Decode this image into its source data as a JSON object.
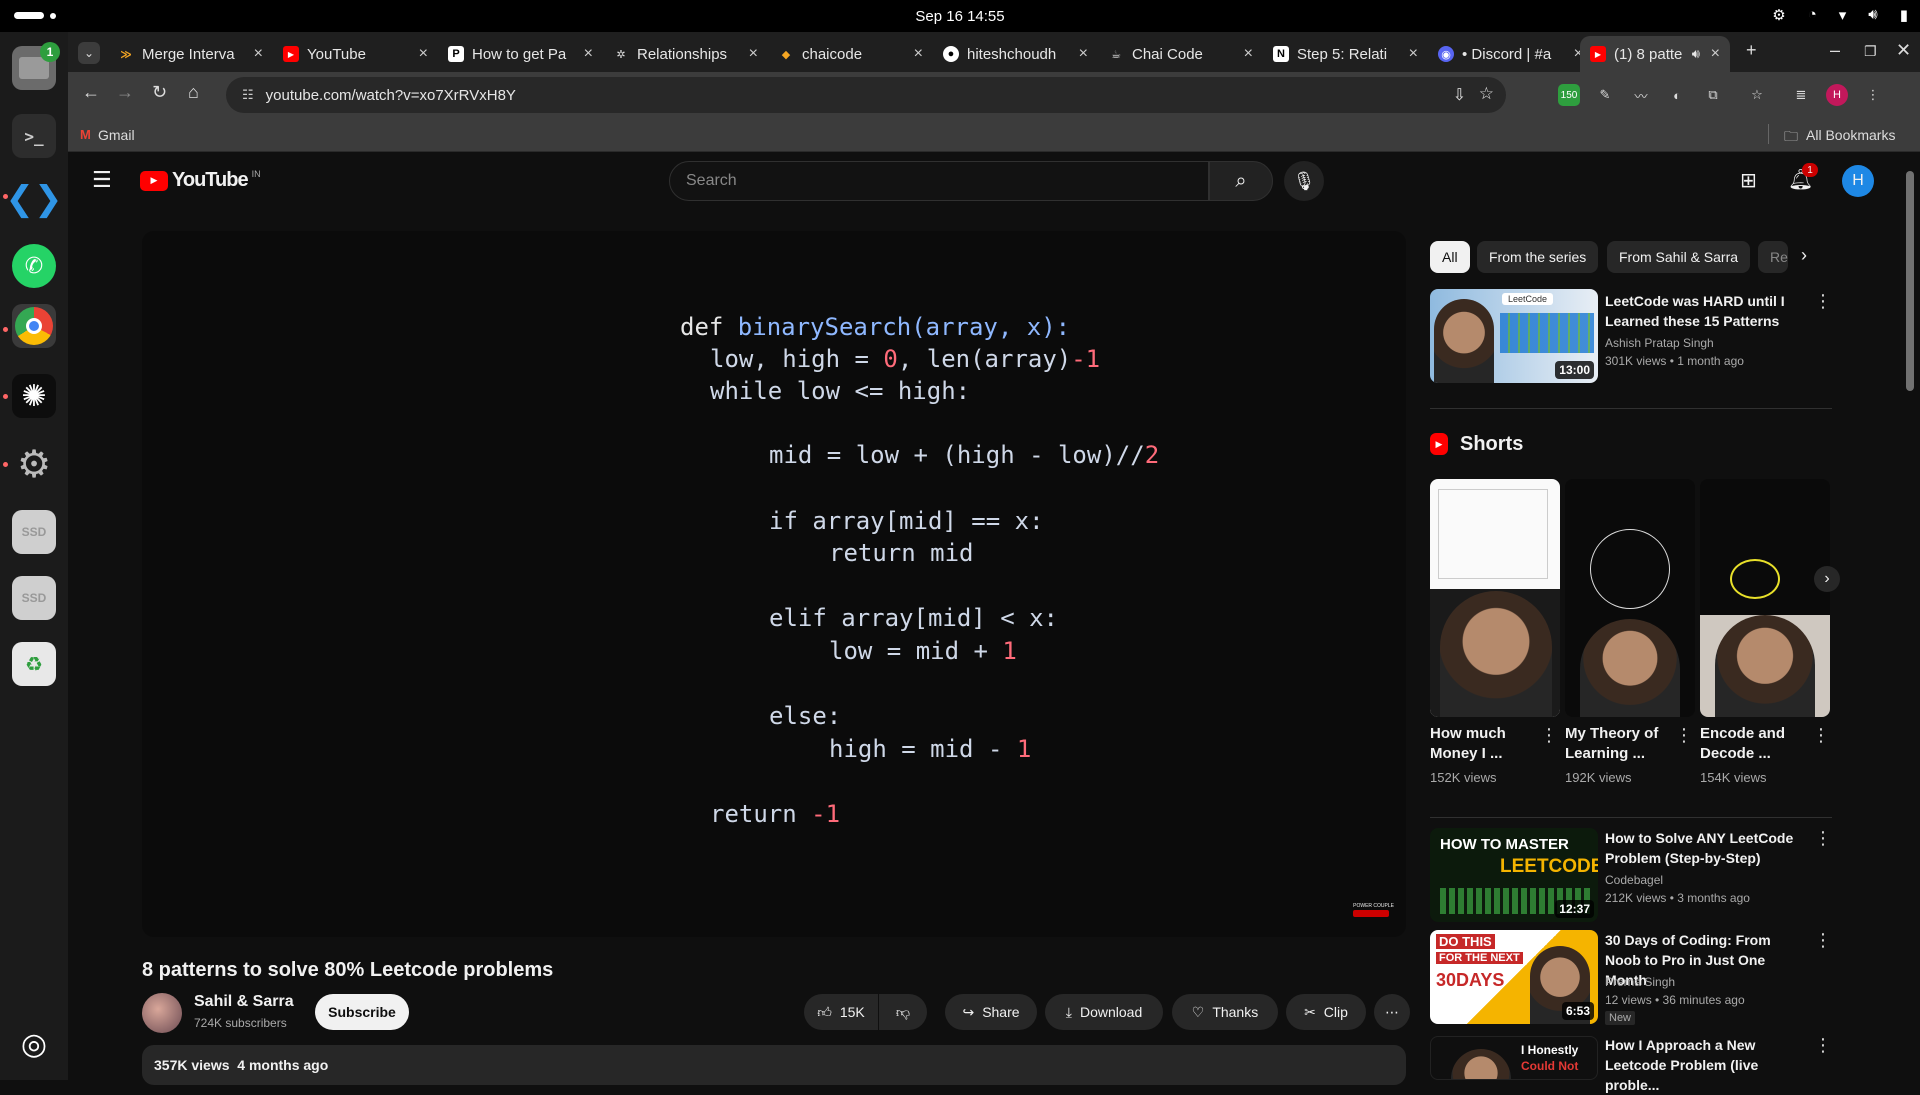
{
  "system": {
    "clock": "Sep 16  14:55",
    "dock_badge": "1",
    "ssd_label": "SSD"
  },
  "browser": {
    "tabs": [
      {
        "label": "Merge Interva",
        "favicon": "chevron-icon",
        "color": "#f5a623"
      },
      {
        "label": "YouTube",
        "favicon": "youtube-icon",
        "color": "#ff0000"
      },
      {
        "label": "How to get Pa",
        "favicon": "p-icon",
        "color": "#ffffff"
      },
      {
        "label": "Relationships",
        "favicon": "gear-icon",
        "color": "#dddddd"
      },
      {
        "label": "chaicode",
        "favicon": "chaicode-icon",
        "color": "#f5a623"
      },
      {
        "label": "hiteshchoudh",
        "favicon": "github-icon",
        "color": "#ffffff"
      },
      {
        "label": "Chai Code",
        "favicon": "cup-icon",
        "color": "#dddddd"
      },
      {
        "label": "Step 5: Relati",
        "favicon": "notion-icon",
        "color": "#ffffff"
      },
      {
        "label": "• Discord | #a",
        "favicon": "discord-icon",
        "color": "#5865f2"
      },
      {
        "label": "(1) 8 patte",
        "favicon": "youtube-icon",
        "color": "#ff0000",
        "active": true
      }
    ],
    "url": "youtube.com/watch?v=xo7XrRVxH8Y",
    "bookmark_gmail": "Gmail",
    "all_bookmarks": "All Bookmarks",
    "ext_badge": "150",
    "profile_initial": "H"
  },
  "youtube": {
    "logo_text": "YouTube",
    "region": "IN",
    "search_placeholder": "Search",
    "notifications_count": "1",
    "avatar_initial": "H",
    "video_title": "8 patterns to solve 80% Leetcode problems",
    "channel": "Sahil & Sarra",
    "subscribers": "724K subscribers",
    "subscribe_label": "Subscribe",
    "likes": "15K",
    "share_label": "Share",
    "download_label": "Download",
    "thanks_label": "Thanks",
    "clip_label": "Clip",
    "views": "357K views",
    "age": "4 months ago",
    "watermark": "POWER COUPLE",
    "code_lines": [
      "def binarySearch(array, x):",
      "low, high = 0, len(array)-1",
      "while low <= high:",
      "mid = low + (high - low)//2",
      "if array[mid] == x:",
      "return mid",
      "elif array[mid] < x:",
      "low = mid + 1",
      "else:",
      "high = mid - 1",
      "return -1"
    ],
    "chips": [
      "All",
      "From the series",
      "From Sahil & Sarra",
      "Re"
    ],
    "shorts_heading": "Shorts",
    "recommended": [
      {
        "title": "LeetCode was HARD until I Learned these 15 Patterns",
        "channel": "Ashish Pratap Singh",
        "meta": "301K views • 1 month ago",
        "duration": "13:00"
      },
      {
        "title": "How to Solve ANY LeetCode Problem (Step-by-Step)",
        "channel": "Codebagel",
        "meta": "212K views • 3 months ago",
        "duration": "12:37"
      },
      {
        "title": "30 Days of Coding: From Noob to Pro in Just One Month",
        "channel": "Prerna Singh",
        "meta": "12 views • 36 minutes ago",
        "duration": "6:53",
        "badge": "New"
      },
      {
        "title": "How I Approach a New Leetcode Problem (live proble...",
        "channel": "",
        "meta": "",
        "duration": ""
      }
    ],
    "shorts": [
      {
        "title": "How much Money I ...",
        "views": "152K views"
      },
      {
        "title": "My Theory of Learning ...",
        "views": "192K views"
      },
      {
        "title": "Encode and Decode ...",
        "views": "154K views"
      }
    ],
    "thumb_texts": {
      "leetcode_badge": "LeetCode",
      "how_to_master": "HOW TO MASTER",
      "leetcode_big": "LEETCODE",
      "do_this": "DO THIS",
      "for_the_next": "FOR THE NEXT",
      "days_30": "30DAYS",
      "honestly": "I Honestly",
      "could_not": "Could Not"
    }
  }
}
